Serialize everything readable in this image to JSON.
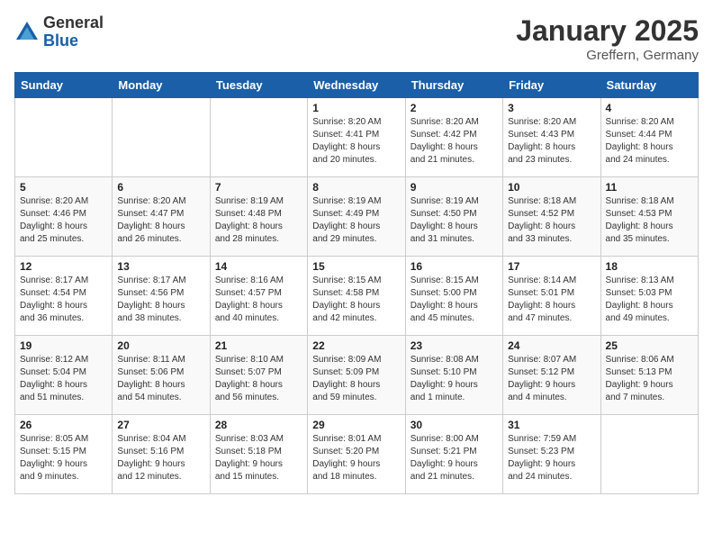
{
  "logo": {
    "general": "General",
    "blue": "Blue"
  },
  "title": "January 2025",
  "location": "Greffern, Germany",
  "weekdays": [
    "Sunday",
    "Monday",
    "Tuesday",
    "Wednesday",
    "Thursday",
    "Friday",
    "Saturday"
  ],
  "weeks": [
    [
      {
        "day": "",
        "info": ""
      },
      {
        "day": "",
        "info": ""
      },
      {
        "day": "",
        "info": ""
      },
      {
        "day": "1",
        "info": "Sunrise: 8:20 AM\nSunset: 4:41 PM\nDaylight: 8 hours\nand 20 minutes."
      },
      {
        "day": "2",
        "info": "Sunrise: 8:20 AM\nSunset: 4:42 PM\nDaylight: 8 hours\nand 21 minutes."
      },
      {
        "day": "3",
        "info": "Sunrise: 8:20 AM\nSunset: 4:43 PM\nDaylight: 8 hours\nand 23 minutes."
      },
      {
        "day": "4",
        "info": "Sunrise: 8:20 AM\nSunset: 4:44 PM\nDaylight: 8 hours\nand 24 minutes."
      }
    ],
    [
      {
        "day": "5",
        "info": "Sunrise: 8:20 AM\nSunset: 4:46 PM\nDaylight: 8 hours\nand 25 minutes."
      },
      {
        "day": "6",
        "info": "Sunrise: 8:20 AM\nSunset: 4:47 PM\nDaylight: 8 hours\nand 26 minutes."
      },
      {
        "day": "7",
        "info": "Sunrise: 8:19 AM\nSunset: 4:48 PM\nDaylight: 8 hours\nand 28 minutes."
      },
      {
        "day": "8",
        "info": "Sunrise: 8:19 AM\nSunset: 4:49 PM\nDaylight: 8 hours\nand 29 minutes."
      },
      {
        "day": "9",
        "info": "Sunrise: 8:19 AM\nSunset: 4:50 PM\nDaylight: 8 hours\nand 31 minutes."
      },
      {
        "day": "10",
        "info": "Sunrise: 8:18 AM\nSunset: 4:52 PM\nDaylight: 8 hours\nand 33 minutes."
      },
      {
        "day": "11",
        "info": "Sunrise: 8:18 AM\nSunset: 4:53 PM\nDaylight: 8 hours\nand 35 minutes."
      }
    ],
    [
      {
        "day": "12",
        "info": "Sunrise: 8:17 AM\nSunset: 4:54 PM\nDaylight: 8 hours\nand 36 minutes."
      },
      {
        "day": "13",
        "info": "Sunrise: 8:17 AM\nSunset: 4:56 PM\nDaylight: 8 hours\nand 38 minutes."
      },
      {
        "day": "14",
        "info": "Sunrise: 8:16 AM\nSunset: 4:57 PM\nDaylight: 8 hours\nand 40 minutes."
      },
      {
        "day": "15",
        "info": "Sunrise: 8:15 AM\nSunset: 4:58 PM\nDaylight: 8 hours\nand 42 minutes."
      },
      {
        "day": "16",
        "info": "Sunrise: 8:15 AM\nSunset: 5:00 PM\nDaylight: 8 hours\nand 45 minutes."
      },
      {
        "day": "17",
        "info": "Sunrise: 8:14 AM\nSunset: 5:01 PM\nDaylight: 8 hours\nand 47 minutes."
      },
      {
        "day": "18",
        "info": "Sunrise: 8:13 AM\nSunset: 5:03 PM\nDaylight: 8 hours\nand 49 minutes."
      }
    ],
    [
      {
        "day": "19",
        "info": "Sunrise: 8:12 AM\nSunset: 5:04 PM\nDaylight: 8 hours\nand 51 minutes."
      },
      {
        "day": "20",
        "info": "Sunrise: 8:11 AM\nSunset: 5:06 PM\nDaylight: 8 hours\nand 54 minutes."
      },
      {
        "day": "21",
        "info": "Sunrise: 8:10 AM\nSunset: 5:07 PM\nDaylight: 8 hours\nand 56 minutes."
      },
      {
        "day": "22",
        "info": "Sunrise: 8:09 AM\nSunset: 5:09 PM\nDaylight: 8 hours\nand 59 minutes."
      },
      {
        "day": "23",
        "info": "Sunrise: 8:08 AM\nSunset: 5:10 PM\nDaylight: 9 hours\nand 1 minute."
      },
      {
        "day": "24",
        "info": "Sunrise: 8:07 AM\nSunset: 5:12 PM\nDaylight: 9 hours\nand 4 minutes."
      },
      {
        "day": "25",
        "info": "Sunrise: 8:06 AM\nSunset: 5:13 PM\nDaylight: 9 hours\nand 7 minutes."
      }
    ],
    [
      {
        "day": "26",
        "info": "Sunrise: 8:05 AM\nSunset: 5:15 PM\nDaylight: 9 hours\nand 9 minutes."
      },
      {
        "day": "27",
        "info": "Sunrise: 8:04 AM\nSunset: 5:16 PM\nDaylight: 9 hours\nand 12 minutes."
      },
      {
        "day": "28",
        "info": "Sunrise: 8:03 AM\nSunset: 5:18 PM\nDaylight: 9 hours\nand 15 minutes."
      },
      {
        "day": "29",
        "info": "Sunrise: 8:01 AM\nSunset: 5:20 PM\nDaylight: 9 hours\nand 18 minutes."
      },
      {
        "day": "30",
        "info": "Sunrise: 8:00 AM\nSunset: 5:21 PM\nDaylight: 9 hours\nand 21 minutes."
      },
      {
        "day": "31",
        "info": "Sunrise: 7:59 AM\nSunset: 5:23 PM\nDaylight: 9 hours\nand 24 minutes."
      },
      {
        "day": "",
        "info": ""
      }
    ]
  ]
}
